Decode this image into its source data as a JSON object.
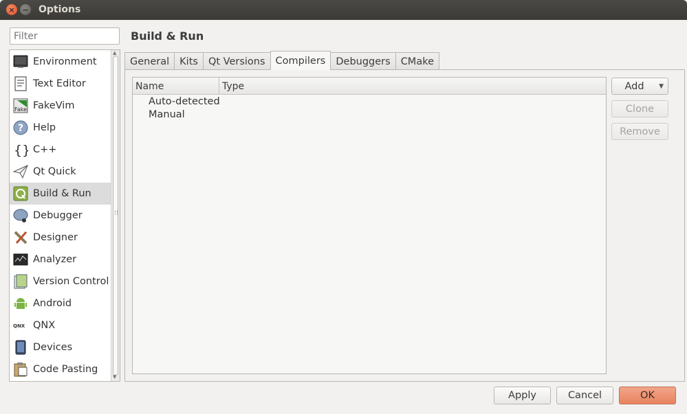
{
  "window": {
    "title": "Options"
  },
  "filter": {
    "placeholder": "Filter"
  },
  "categories": [
    {
      "label": "Environment",
      "icon": "monitor-icon"
    },
    {
      "label": "Text Editor",
      "icon": "text-editor-icon"
    },
    {
      "label": "FakeVim",
      "icon": "fakevim-icon"
    },
    {
      "label": "Help",
      "icon": "help-icon"
    },
    {
      "label": "C++",
      "icon": "braces-icon"
    },
    {
      "label": "Qt Quick",
      "icon": "paper-plane-icon"
    },
    {
      "label": "Build & Run",
      "icon": "build-run-icon",
      "selected": true
    },
    {
      "label": "Debugger",
      "icon": "debugger-icon"
    },
    {
      "label": "Designer",
      "icon": "designer-icon"
    },
    {
      "label": "Analyzer",
      "icon": "analyzer-icon"
    },
    {
      "label": "Version Control",
      "icon": "version-control-icon"
    },
    {
      "label": "Android",
      "icon": "android-icon"
    },
    {
      "label": "QNX",
      "icon": "qnx-icon"
    },
    {
      "label": "Devices",
      "icon": "devices-icon"
    },
    {
      "label": "Code Pasting",
      "icon": "code-pasting-icon"
    }
  ],
  "page": {
    "title": "Build & Run",
    "tabs": [
      {
        "label": "General"
      },
      {
        "label": "Kits"
      },
      {
        "label": "Qt Versions"
      },
      {
        "label": "Compilers",
        "active": true
      },
      {
        "label": "Debuggers"
      },
      {
        "label": "CMake"
      }
    ]
  },
  "compilers": {
    "columns": [
      "Name",
      "Type"
    ],
    "rows": [
      "Auto-detected",
      "Manual"
    ]
  },
  "side_buttons": {
    "add": "Add",
    "clone": "Clone",
    "remove": "Remove"
  },
  "footer": {
    "apply": "Apply",
    "cancel": "Cancel",
    "ok": "OK"
  },
  "colors": {
    "titlebar": "#3b3a36",
    "close": "#e0502b",
    "selected_row": "#dcdcdc"
  }
}
